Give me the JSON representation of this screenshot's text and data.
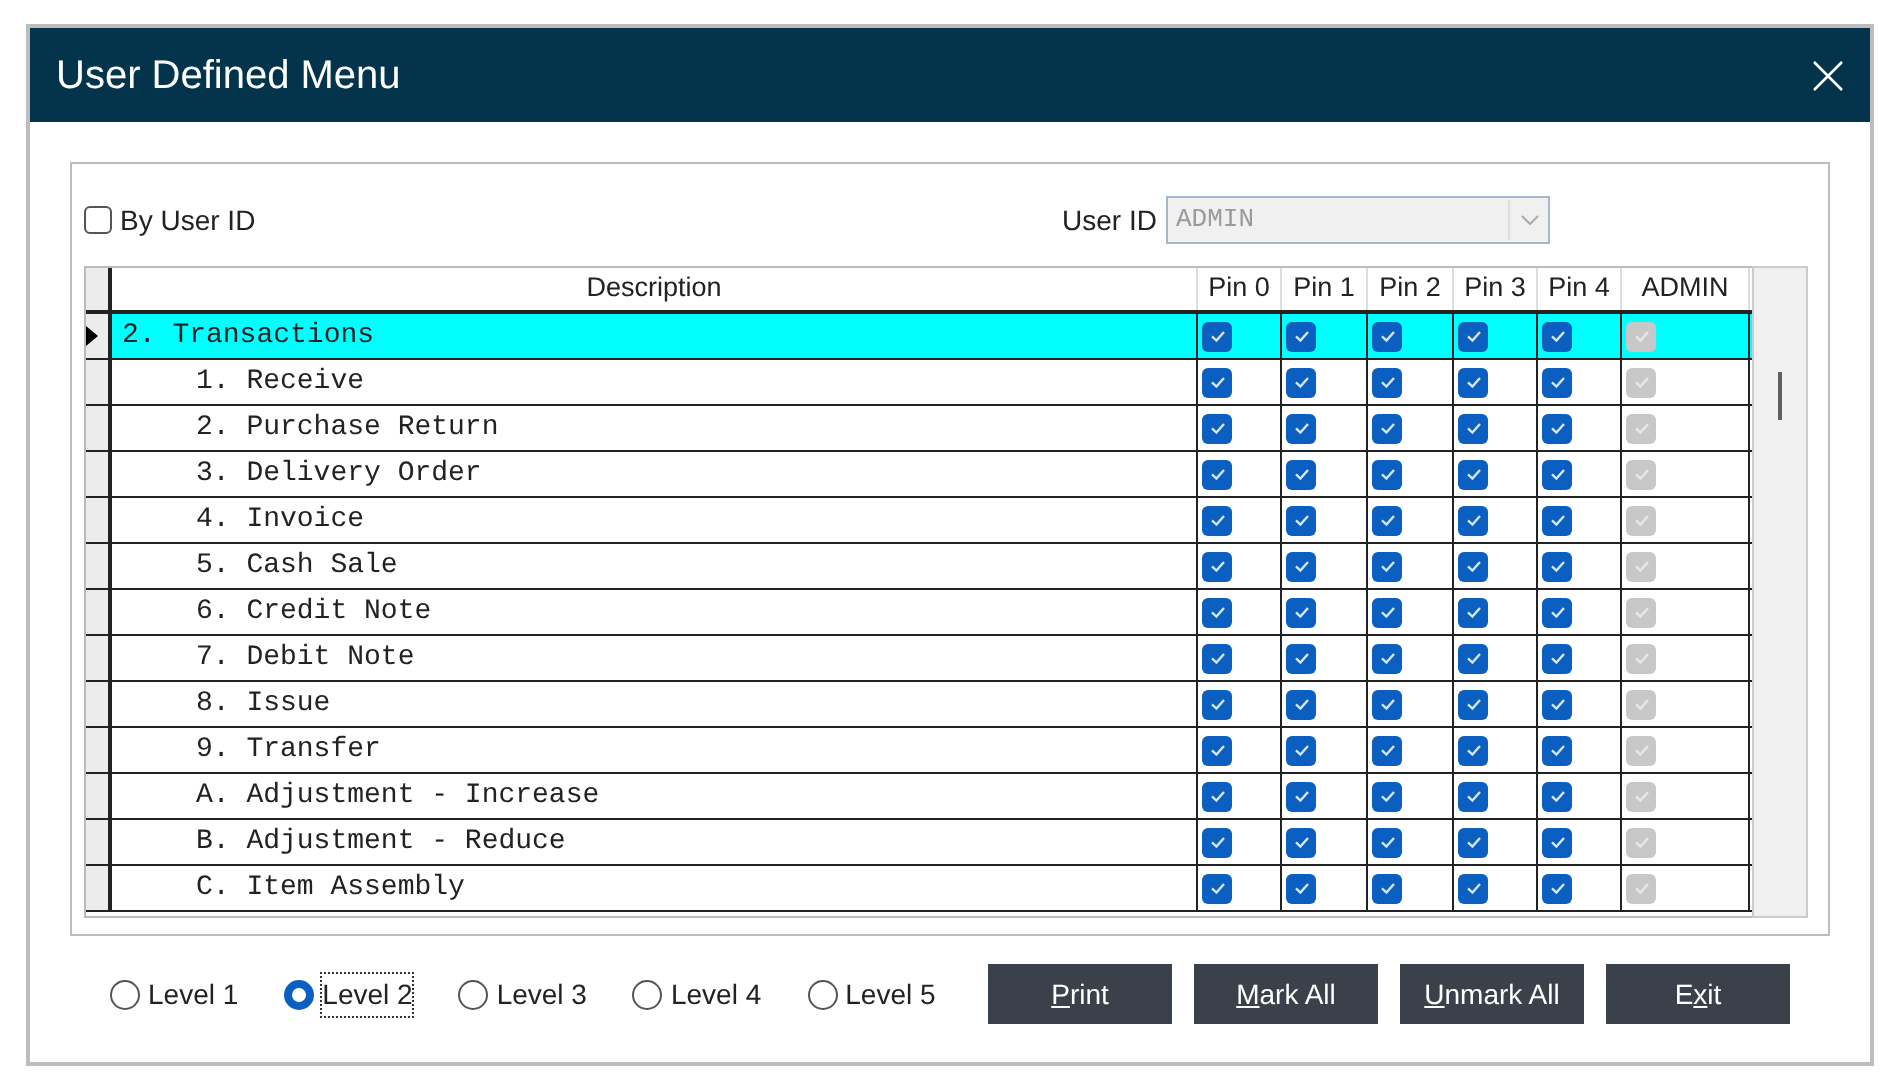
{
  "window": {
    "title": "User Defined Menu"
  },
  "by_user_id": {
    "label": "By User ID",
    "checked": false
  },
  "user_id": {
    "label": "User ID",
    "value": "ADMIN",
    "disabled": true
  },
  "table": {
    "columns": [
      "Description",
      "Pin 0",
      "Pin 1",
      "Pin 2",
      "Pin 3",
      "Pin 4",
      "ADMIN"
    ],
    "rows": [
      {
        "description": "2. Transactions",
        "selected": true,
        "checks": [
          {
            "checked": true,
            "disabled": false
          },
          {
            "checked": true,
            "disabled": false
          },
          {
            "checked": true,
            "disabled": false
          },
          {
            "checked": true,
            "disabled": false
          },
          {
            "checked": true,
            "disabled": false
          },
          {
            "checked": true,
            "disabled": true
          }
        ],
        "children": [
          {
            "description": "1. Receive",
            "selected": false,
            "checks": [
              {
                "checked": true,
                "disabled": false
              },
              {
                "checked": true,
                "disabled": false
              },
              {
                "checked": true,
                "disabled": false
              },
              {
                "checked": true,
                "disabled": false
              },
              {
                "checked": true,
                "disabled": false
              },
              {
                "checked": true,
                "disabled": true
              }
            ]
          },
          {
            "description": "2. Purchase Return",
            "selected": false,
            "checks": [
              {
                "checked": true,
                "disabled": false
              },
              {
                "checked": true,
                "disabled": false
              },
              {
                "checked": true,
                "disabled": false
              },
              {
                "checked": true,
                "disabled": false
              },
              {
                "checked": true,
                "disabled": false
              },
              {
                "checked": true,
                "disabled": true
              }
            ]
          },
          {
            "description": "3. Delivery Order",
            "selected": false,
            "checks": [
              {
                "checked": true,
                "disabled": false
              },
              {
                "checked": true,
                "disabled": false
              },
              {
                "checked": true,
                "disabled": false
              },
              {
                "checked": true,
                "disabled": false
              },
              {
                "checked": true,
                "disabled": false
              },
              {
                "checked": true,
                "disabled": true
              }
            ]
          },
          {
            "description": "4. Invoice",
            "selected": false,
            "checks": [
              {
                "checked": true,
                "disabled": false
              },
              {
                "checked": true,
                "disabled": false
              },
              {
                "checked": true,
                "disabled": false
              },
              {
                "checked": true,
                "disabled": false
              },
              {
                "checked": true,
                "disabled": false
              },
              {
                "checked": true,
                "disabled": true
              }
            ]
          },
          {
            "description": "5. Cash Sale",
            "selected": false,
            "checks": [
              {
                "checked": true,
                "disabled": false
              },
              {
                "checked": true,
                "disabled": false
              },
              {
                "checked": true,
                "disabled": false
              },
              {
                "checked": true,
                "disabled": false
              },
              {
                "checked": true,
                "disabled": false
              },
              {
                "checked": true,
                "disabled": true
              }
            ]
          },
          {
            "description": "6. Credit Note",
            "selected": false,
            "checks": [
              {
                "checked": true,
                "disabled": false
              },
              {
                "checked": true,
                "disabled": false
              },
              {
                "checked": true,
                "disabled": false
              },
              {
                "checked": true,
                "disabled": false
              },
              {
                "checked": true,
                "disabled": false
              },
              {
                "checked": true,
                "disabled": true
              }
            ]
          },
          {
            "description": "7. Debit Note",
            "selected": false,
            "checks": [
              {
                "checked": true,
                "disabled": false
              },
              {
                "checked": true,
                "disabled": false
              },
              {
                "checked": true,
                "disabled": false
              },
              {
                "checked": true,
                "disabled": false
              },
              {
                "checked": true,
                "disabled": false
              },
              {
                "checked": true,
                "disabled": true
              }
            ]
          },
          {
            "description": "8. Issue",
            "selected": false,
            "checks": [
              {
                "checked": true,
                "disabled": false
              },
              {
                "checked": true,
                "disabled": false
              },
              {
                "checked": true,
                "disabled": false
              },
              {
                "checked": true,
                "disabled": false
              },
              {
                "checked": true,
                "disabled": false
              },
              {
                "checked": true,
                "disabled": true
              }
            ]
          },
          {
            "description": "9. Transfer",
            "selected": false,
            "checks": [
              {
                "checked": true,
                "disabled": false
              },
              {
                "checked": true,
                "disabled": false
              },
              {
                "checked": true,
                "disabled": false
              },
              {
                "checked": true,
                "disabled": false
              },
              {
                "checked": true,
                "disabled": false
              },
              {
                "checked": true,
                "disabled": true
              }
            ]
          },
          {
            "description": "A. Adjustment - Increase",
            "selected": false,
            "checks": [
              {
                "checked": true,
                "disabled": false
              },
              {
                "checked": true,
                "disabled": false
              },
              {
                "checked": true,
                "disabled": false
              },
              {
                "checked": true,
                "disabled": false
              },
              {
                "checked": true,
                "disabled": false
              },
              {
                "checked": true,
                "disabled": true
              }
            ]
          },
          {
            "description": "B. Adjustment - Reduce",
            "selected": false,
            "checks": [
              {
                "checked": true,
                "disabled": false
              },
              {
                "checked": true,
                "disabled": false
              },
              {
                "checked": true,
                "disabled": false
              },
              {
                "checked": true,
                "disabled": false
              },
              {
                "checked": true,
                "disabled": false
              },
              {
                "checked": true,
                "disabled": true
              }
            ]
          },
          {
            "description": "C. Item Assembly",
            "selected": false,
            "checks": [
              {
                "checked": true,
                "disabled": false
              },
              {
                "checked": true,
                "disabled": false
              },
              {
                "checked": true,
                "disabled": false
              },
              {
                "checked": true,
                "disabled": false
              },
              {
                "checked": true,
                "disabled": false
              },
              {
                "checked": true,
                "disabled": true
              }
            ]
          }
        ]
      }
    ]
  },
  "levels": [
    {
      "label": "Level 1",
      "selected": false
    },
    {
      "label": "Level 2",
      "selected": true
    },
    {
      "label": "Level 3",
      "selected": false
    },
    {
      "label": "Level 4",
      "selected": false
    },
    {
      "label": "Level 5",
      "selected": false
    }
  ],
  "buttons": [
    {
      "key": "P",
      "after": "rint"
    },
    {
      "key": "M",
      "after": "ark All"
    },
    {
      "key": "U",
      "after": "nmark All"
    },
    {
      "before": "E",
      "key": "x",
      "after": "it"
    }
  ]
}
